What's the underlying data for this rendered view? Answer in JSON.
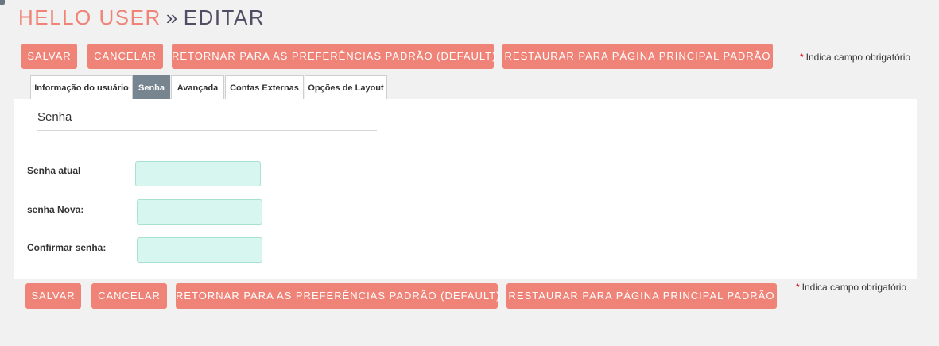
{
  "header": {
    "user": "HELLO USER",
    "separator": "»",
    "action": "EDITAR"
  },
  "actions": {
    "save": "SALVAR",
    "cancel": "CANCELAR",
    "reset_prefs": "RETORNAR PARA AS PREFERÊNCIAS PADRÃO (DEFAULT)",
    "reset_home": "RESTAURAR PARA PÁGINA PRINCIPAL PADRÃO"
  },
  "required_note": {
    "star": "*",
    "text": "Indica campo obrigatório"
  },
  "tabs": [
    {
      "label": "Informação do usuário",
      "active": false
    },
    {
      "label": "Senha",
      "active": true
    },
    {
      "label": "Avançada",
      "active": false
    },
    {
      "label": "Contas Externas",
      "active": false
    },
    {
      "label": "Opções de Layout",
      "active": false
    }
  ],
  "section": {
    "title": "Senha"
  },
  "fields": {
    "current_password": {
      "label": "Senha atual",
      "value": ""
    },
    "new_password": {
      "label": "senha Nova:",
      "value": ""
    },
    "confirm_password": {
      "label": "Confirmar senha:",
      "value": ""
    }
  },
  "colors": {
    "accent": "#f08377",
    "title_dark": "#534d64",
    "tab_active": "#778591",
    "input_bg": "#d6f6ef",
    "required_star": "#d0021b"
  }
}
